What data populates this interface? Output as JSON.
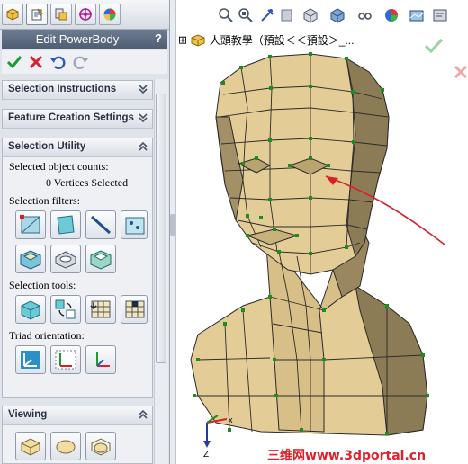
{
  "panel": {
    "tabs": [
      {
        "icon": "feature-manager-icon"
      },
      {
        "icon": "property-manager-icon"
      },
      {
        "icon": "configuration-manager-icon"
      },
      {
        "icon": "dimxpert-icon"
      },
      {
        "icon": "display-manager-icon"
      }
    ],
    "title": "Edit PowerBody",
    "help_label": "?",
    "actions": [
      "ok-check-icon",
      "cancel-x-icon",
      "undo-icon",
      "redo-icon"
    ],
    "sections": {
      "selection_instructions": {
        "label": "Selection Instructions",
        "state": "collapsed"
      },
      "feature_creation_settings": {
        "label": "Feature Creation Settings",
        "state": "collapsed"
      },
      "selection_utility": {
        "label": "Selection Utility",
        "state": "expanded",
        "counts_label": "Selected object counts:",
        "counts_value": "0 Vertices Selected",
        "filters_label": "Selection filters:",
        "tools_label": "Selection tools:",
        "triad_label": "Triad orientation:"
      },
      "viewing": {
        "label": "Viewing",
        "state": "expanded"
      }
    }
  },
  "viewport": {
    "toolbar": [
      "zoom-to-fit-icon",
      "zoom-to-area-icon",
      "previous-view-icon",
      "section-view-icon",
      "view-orientation-icon",
      "display-style-icon",
      "hide-show-icon",
      "edit-appearance-icon",
      "apply-scene-icon",
      "view-settings-icon"
    ],
    "tree": {
      "expand": "⊞",
      "label": "人頭教學（預設＜＜預設＞_..."
    },
    "triad_axes": {
      "x": "x",
      "y": "Y",
      "z": "Z"
    },
    "watermark": "三维网www.3dportal.cn",
    "colors": {
      "mesh_face": "#e3cc96",
      "mesh_shadow": "#8c7c56",
      "edge_point": "#1e8c1e",
      "accent_arrow": "#d8202a",
      "title_bar": "#5c6a80"
    }
  }
}
